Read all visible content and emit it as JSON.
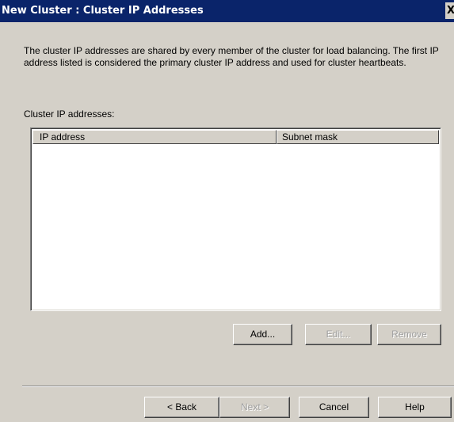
{
  "window": {
    "title": "New Cluster : Cluster IP Addresses",
    "close_glyph": "X"
  },
  "description": "The cluster IP addresses are shared by every member of the cluster for load balancing. The first IP address listed is considered the primary cluster IP address and used for cluster heartbeats.",
  "list": {
    "label": "Cluster IP addresses:",
    "columns": [
      "IP address",
      "Subnet mask"
    ],
    "rows": []
  },
  "list_buttons": {
    "add": "Add...",
    "edit": "Edit...",
    "remove": "Remove"
  },
  "footer_buttons": {
    "back": "< Back",
    "next": "Next >",
    "cancel": "Cancel",
    "help": "Help"
  },
  "colors": {
    "titlebar": "#0a246a",
    "dialog_face": "#d4d0c8",
    "disabled_text": "#a0a0a0"
  }
}
